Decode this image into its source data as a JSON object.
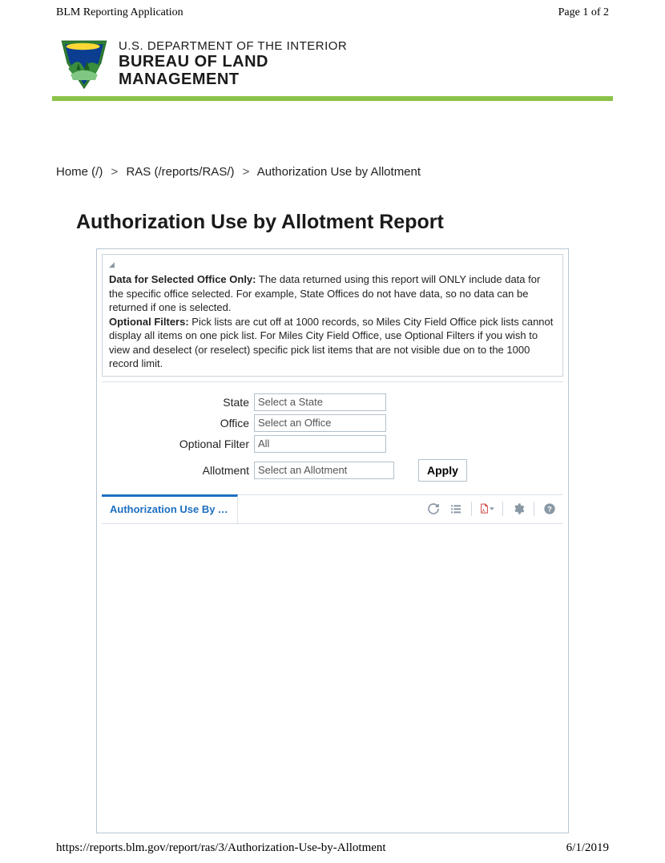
{
  "header": {
    "app_name": "BLM Reporting Application",
    "page_counter": "Page 1 of 2"
  },
  "brand": {
    "department": "U.S. DEPARTMENT OF THE INTERIOR",
    "bureau_line1": "BUREAU OF LAND",
    "bureau_line2": "MANAGEMENT"
  },
  "breadcrumb": {
    "home": "Home (/)",
    "ras": "RAS (/reports/RAS/)",
    "current": "Authorization Use by Allotment",
    "sep": ">"
  },
  "page_title": "Authorization Use by Allotment Report",
  "info": {
    "b1_label": "Data for Selected Office Only:",
    "b1_text": " The data returned using this report will ONLY include data for the specific office selected. For example, State Offices do not have data, so no data can be returned if one is selected.",
    "b2_label": "Optional Filters:",
    "b2_text": " Pick lists are cut off at 1000 records, so Miles City Field Office pick lists cannot display all items on one pick list. For Miles City Field Office, use Optional Filters if you wish to view and deselect (or reselect) specific pick list items that are not visible due on to the 1000 record limit."
  },
  "filters": {
    "state": {
      "label": "State",
      "value": "Select a State"
    },
    "office": {
      "label": "Office",
      "value": "Select an Office"
    },
    "optional": {
      "label": "Optional Filter",
      "value": "All"
    },
    "allotment": {
      "label": "Allotment",
      "value": "Select an Allotment"
    },
    "apply": "Apply"
  },
  "tab": {
    "label": "Authorization Use By Al..."
  },
  "footer": {
    "url": "https://reports.blm.gov/report/ras/3/Authorization-Use-by-Allotment",
    "date": "6/1/2019"
  }
}
